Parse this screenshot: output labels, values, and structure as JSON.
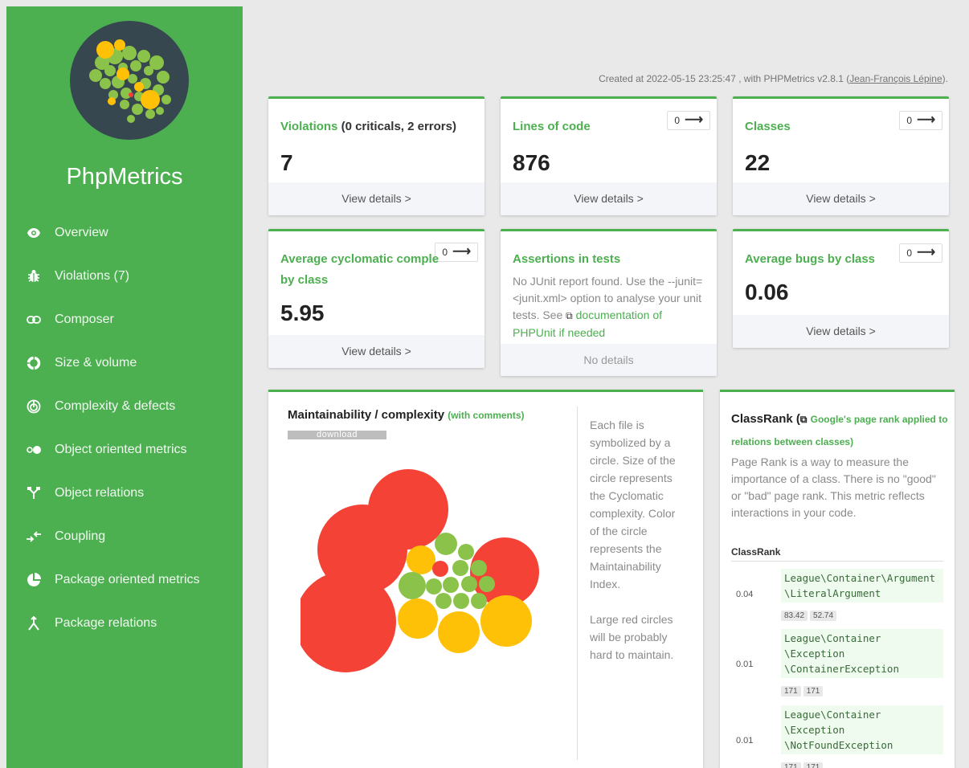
{
  "app": {
    "brand": "PhpMetrics"
  },
  "sidebar": {
    "items": [
      {
        "label": "Overview",
        "icon": "eye-icon"
      },
      {
        "label": "Violations (7)",
        "icon": "bug-icon"
      },
      {
        "label": "Composer",
        "icon": "link-icon"
      },
      {
        "label": "Size & volume",
        "icon": "pie-segments-icon"
      },
      {
        "label": "Complexity & defects",
        "icon": "spiral-icon"
      },
      {
        "label": "Object oriented metrics",
        "icon": "dots-icon"
      },
      {
        "label": "Object relations",
        "icon": "fork-icon"
      },
      {
        "label": "Coupling",
        "icon": "arrows-icon"
      },
      {
        "label": "Package oriented metrics",
        "icon": "pie-chart-icon"
      },
      {
        "label": "Package relations",
        "icon": "merge-icon"
      }
    ]
  },
  "header": {
    "created_prefix": "Created at 2022-05-15 23:25:47 , with PHPMetrics v2.8.1 (",
    "author": "Jean-François Lépine",
    "created_suffix": ")."
  },
  "cards": {
    "violations": {
      "title": "Violations",
      "extra": " (0 criticals, 2 errors)",
      "value": "7",
      "footer": "View details >"
    },
    "loc": {
      "title": "Lines of code",
      "value": "876",
      "footer": "View details >",
      "trend": "0"
    },
    "classes": {
      "title": "Classes",
      "value": "22",
      "footer": "View details >",
      "trend": "0"
    },
    "ccn": {
      "title_line1": "Average cyclomatic comple",
      "title_line2": "by class",
      "value": "5.95",
      "footer": "View details >",
      "trend": "0"
    },
    "assertions": {
      "title": "Assertions in tests",
      "desc": "No JUnit report found. Use the --junit=<junit.xml> option to analyse your unit tests. See ",
      "link_icon": "external-link-icon",
      "link": "documentation of PHPUnit if needed",
      "footer": "No details"
    },
    "bugs": {
      "title": "Average bugs by class",
      "value": "0.06",
      "footer": "View details >",
      "trend": "0"
    }
  },
  "maintainability": {
    "title": "Maintainability / complexity",
    "subtitle": "(with comments)",
    "download": "download",
    "desc1": "Each file is symbolized by a circle. Size of the circle represents the Cyclomatic complexity. Color of the circle represents the Maintainability Index.",
    "desc2": "Large red circles will be probably hard to maintain.",
    "colors": {
      "red": "#f44336",
      "orange": "#ffc107",
      "green": "#8bc34a"
    }
  },
  "classrank": {
    "title": "ClassRank",
    "subtitle": "Google's page rank applied to relations between classes",
    "desc": "Page Rank is a way to measure the importance of a class. There is no \"good\" or \"bad\" page rank. This metric reflects interactions in your code.",
    "table_header": "ClassRank",
    "rows": [
      {
        "rank": "0.04",
        "lines": [
          "League\\Container\\Argument",
          "\\LiteralArgument"
        ],
        "tags": [
          "83.42",
          "52.74"
        ]
      },
      {
        "rank": "0.01",
        "lines": [
          "League\\Container",
          "\\Exception",
          "\\ContainerException"
        ],
        "tags": [
          "171",
          "171"
        ]
      },
      {
        "rank": "0.01",
        "lines": [
          "League\\Container",
          "\\Exception",
          "\\NotFoundException"
        ],
        "tags": [
          "171",
          "171"
        ]
      }
    ]
  },
  "colors": {
    "accent": "#4caf50",
    "sidebar_bg": "#4caf50",
    "logo_bg": "#37474f"
  }
}
